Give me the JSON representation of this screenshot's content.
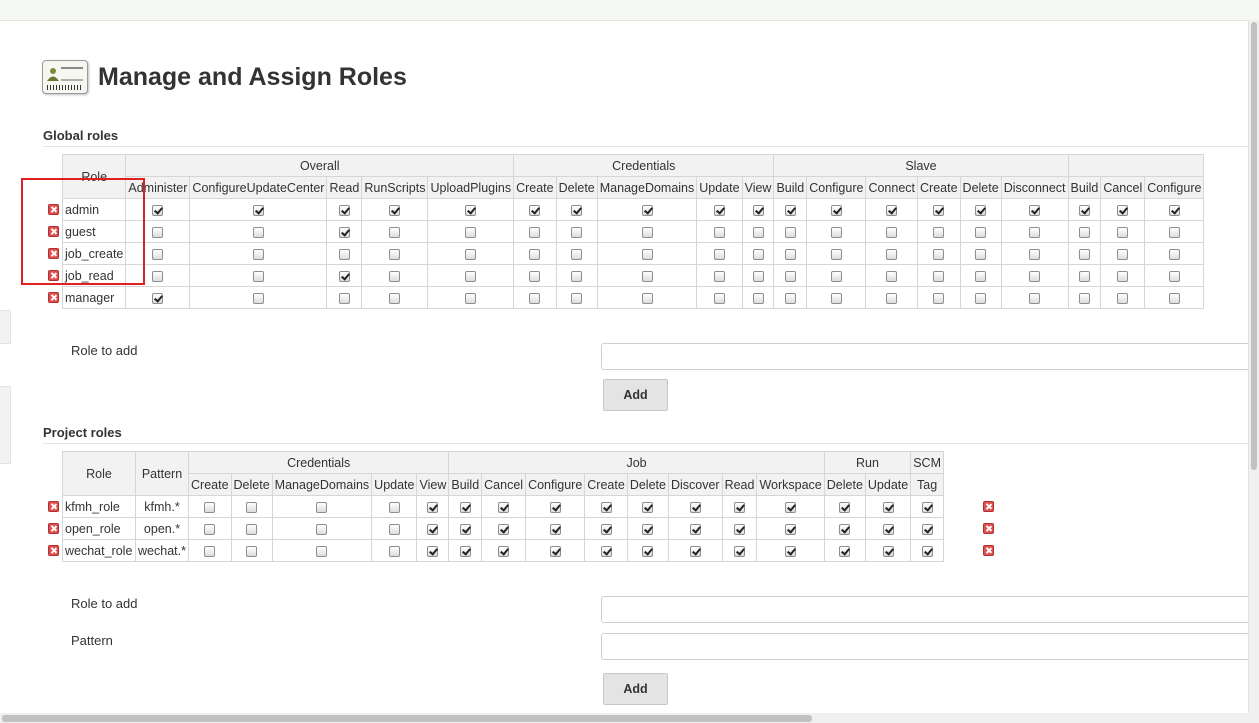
{
  "page": {
    "title": "Manage and Assign Roles"
  },
  "icons": {
    "header": "role-card-icon",
    "delete": "red-x-icon",
    "check": "checkmark-icon"
  },
  "colors": {
    "highlight": "#e02020",
    "delete": "#e05050",
    "header_bg": "#f2f2f2"
  },
  "global": {
    "section_title": "Global roles",
    "role_header": "Role",
    "groups": [
      "Overall",
      "Credentials",
      "Slave",
      ""
    ],
    "permissions": [
      "Administer",
      "ConfigureUpdateCenter",
      "Read",
      "RunScripts",
      "UploadPlugins",
      "Create",
      "Delete",
      "ManageDomains",
      "Update",
      "View",
      "Build",
      "Configure",
      "Connect",
      "Create",
      "Delete",
      "Disconnect",
      "Build",
      "Cancel",
      "Configure"
    ],
    "roles": [
      {
        "name": "admin",
        "checks": [
          1,
          1,
          1,
          1,
          1,
          1,
          1,
          1,
          1,
          1,
          1,
          1,
          1,
          1,
          1,
          1,
          1,
          1,
          1
        ]
      },
      {
        "name": "guest",
        "checks": [
          0,
          0,
          1,
          0,
          0,
          0,
          0,
          0,
          0,
          0,
          0,
          0,
          0,
          0,
          0,
          0,
          0,
          0,
          0
        ]
      },
      {
        "name": "job_create",
        "checks": [
          0,
          0,
          0,
          0,
          0,
          0,
          0,
          0,
          0,
          0,
          0,
          0,
          0,
          0,
          0,
          0,
          0,
          0,
          0
        ]
      },
      {
        "name": "job_read",
        "checks": [
          0,
          0,
          1,
          0,
          0,
          0,
          0,
          0,
          0,
          0,
          0,
          0,
          0,
          0,
          0,
          0,
          0,
          0,
          0
        ]
      },
      {
        "name": "manager",
        "checks": [
          1,
          0,
          0,
          0,
          0,
          0,
          0,
          0,
          0,
          0,
          0,
          0,
          0,
          0,
          0,
          0,
          0,
          0,
          0
        ]
      }
    ],
    "role_to_add_label": "Role to add",
    "add_button": "Add"
  },
  "project": {
    "section_title": "Project roles",
    "role_header": "Role",
    "pattern_header": "Pattern",
    "groups": [
      "Credentials",
      "Job",
      "Run",
      "SCM"
    ],
    "permissions": [
      "Create",
      "Delete",
      "ManageDomains",
      "Update",
      "View",
      "Build",
      "Cancel",
      "Configure",
      "Create",
      "Delete",
      "Discover",
      "Read",
      "Workspace",
      "Delete",
      "Update",
      "Tag"
    ],
    "roles": [
      {
        "name": "kfmh_role",
        "pattern": "kfmh.*",
        "checks": [
          0,
          0,
          0,
          0,
          1,
          1,
          1,
          1,
          1,
          1,
          1,
          1,
          1,
          1,
          1,
          1
        ]
      },
      {
        "name": "open_role",
        "pattern": "open.*",
        "checks": [
          0,
          0,
          0,
          0,
          1,
          1,
          1,
          1,
          1,
          1,
          1,
          1,
          1,
          1,
          1,
          1
        ]
      },
      {
        "name": "wechat_role",
        "pattern": "wechat.*",
        "checks": [
          0,
          0,
          0,
          0,
          1,
          1,
          1,
          1,
          1,
          1,
          1,
          1,
          1,
          1,
          1,
          1
        ]
      }
    ],
    "role_to_add_label": "Role to add",
    "pattern_label": "Pattern",
    "add_button": "Add"
  }
}
